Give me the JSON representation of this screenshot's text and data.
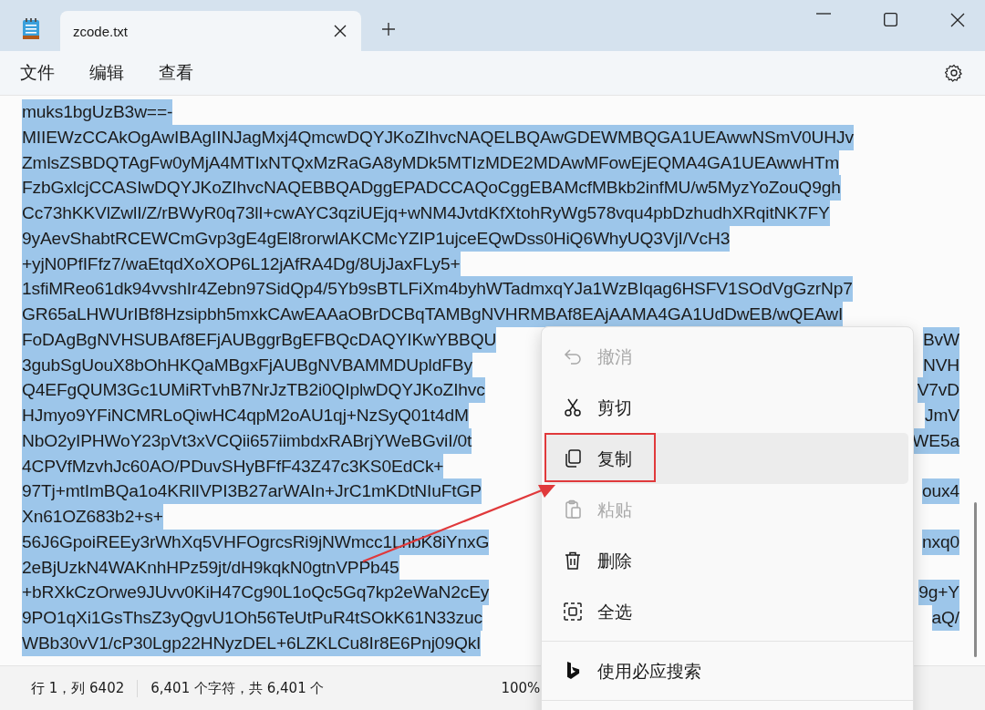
{
  "tabs": [
    {
      "title": "zcode.txt",
      "selected": true
    }
  ],
  "menu": [
    "文件",
    "编辑",
    "查看"
  ],
  "document": {
    "selected": true,
    "lines": [
      {
        "text": "muks1bgUzB3w==-"
      },
      {
        "text": "MIIEWzCCAkOgAwIBAgIINJagMxj4QmcwDQYJKoZIhvcNAQELBQAwGDEWMBQGA1UEAwwNSmV0UHJv"
      },
      {
        "text": "ZmlsZSBDQTAgFw0yMjA4MTIxNTQxMzRaGA8yMDk5MTIzMDE2MDAwMFowEjEQMA4GA1UEAwwHTm"
      },
      {
        "text": "FzbGxlcjCCASIwDQYJKoZIhvcNAQEBBQADggEPADCCAQoCggEBAMcfMBkb2infMU/w5MyzYoZouQ9gh"
      },
      {
        "text": "Cc73hKKVlZwlI/Z/rBWyR0q73lI+cwAYC3qziUEjq+wNM4JvtdKfXtohRyWg578vqu4pbDzhudhXRqitNK7FY"
      },
      {
        "text": "9yAevShabtRCEWCmGvp3gE4gEl8rorwlAKCMcYZIP1ujceEQwDss0HiQ6WhyUQ3VjI/VcH3"
      },
      {
        "text": "+yjN0PfIFfz7/waEtqdXoXOP6L12jAfRA4Dg/8UjJaxFLy5+"
      },
      {
        "text": "1sfiMReo61dk94vvshIr4Zebn97SidQp4/5Yb9sBTLFiXm4byhWTadmxqYJa1WzBIqag6HSFV1SOdVgGzrNp7"
      },
      {
        "text": "GR65aLHWUrIBf8Hzsipbh5mxkCAwEAAaOBrDCBqTAMBgNVHRMBAf8EAjAAMA4GA1UdDwEB/wQEAwI"
      },
      {
        "text": "FoDAgBgNVHSUBAf8EFjAUBggrBgEFBQcDAQYIKwYBBQU",
        "end": "BvW"
      },
      {
        "text": "3gubSgUouX8bOhHKQaMBgxFjAUBgNVBAMMDUpldFBy",
        "end": "NVH"
      },
      {
        "text": "Q4EFgQUM3Gc1UMiRTvhB7NrJzTB2i0QIplwDQYJKoZIhvc",
        "end": "V7vD"
      },
      {
        "text": "HJmyo9YFiNCMRLoQiwHC4qpM2oAU1qj+NzSyQ01t4dM",
        "end": "JmV"
      },
      {
        "text": "NbO2yIPHWoY23pVt3xVCQii657iimbdxRABrjYWeBGviI/0t",
        "end": "WE5a"
      },
      {
        "text": "4CPVfMzvhJc60AO/PDuvSHyBFfF43Z47c3KS0EdCk+"
      },
      {
        "text": "97Tj+mtImBQa1o4KRlIVPI3B27arWAIn+JrC1mKDtNIuFtGP",
        "end": "oux4"
      },
      {
        "text": "Xn61OZ683b2+s+"
      },
      {
        "text": "56J6GpoiREEy3rWhXq5VHFOgrcsRi9jNWmcc1LnbK8iYnxG",
        "end": "nxq0"
      },
      {
        "text": "2eBjUzkN4WAKnhHPz59jt/dH9kqkN0gtnVPPb45"
      },
      {
        "text": "+bRXkCzOrwe9JUvv0KiH47Cg90L1oQc5Gq7kp2eWaN2cEy",
        "end": "9g+Y"
      },
      {
        "text": "9PO1qXi1GsThsZ3yQgvU1Oh56TeUtPuR4tSOkK61N33zuc",
        "end": "aQ/"
      },
      {
        "text": "WBb30vV1/cP30Lgp22HNyzDEL+6LZKLCu8Ir8E6Pnj09QkI"
      }
    ]
  },
  "status_bar": {
    "position": "行 1，列 6402",
    "characters": "6,401 个字符，共 6,401 个",
    "zoom": "100%"
  },
  "context_menu": {
    "items": [
      {
        "kind": "undo",
        "label": "撤消",
        "disabled": true,
        "selected": false
      },
      {
        "kind": "cut",
        "label": "剪切",
        "disabled": false,
        "selected": false
      },
      {
        "kind": "copy",
        "label": "复制",
        "disabled": false,
        "selected": true
      },
      {
        "kind": "paste",
        "label": "粘贴",
        "disabled": true,
        "selected": false
      },
      {
        "kind": "delete",
        "label": "删除",
        "disabled": false,
        "selected": false
      },
      {
        "kind": "select_all",
        "label": "全选",
        "disabled": false,
        "selected": false
      },
      {
        "kind": "search",
        "label": "使用必应搜索",
        "disabled": false,
        "selected": false
      }
    ]
  }
}
